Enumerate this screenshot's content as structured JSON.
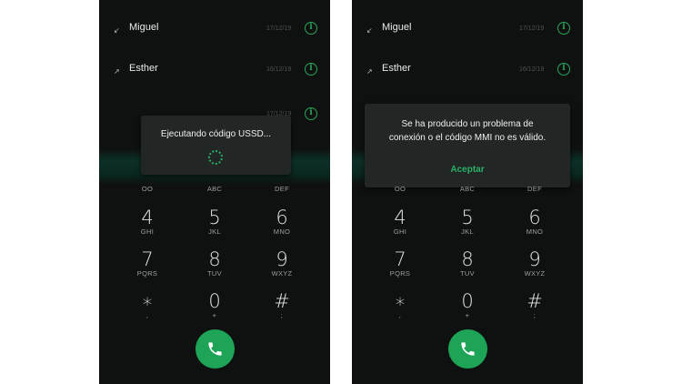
{
  "colors": {
    "accent": "#1ea456",
    "background": "#0e1110",
    "dialog": "#222625"
  },
  "left_screen": {
    "contacts": [
      {
        "name": "Miguel",
        "date": "17/12/19"
      },
      {
        "name": "Esther",
        "date": "16/12/19"
      },
      {
        "name": "",
        "date": "17/12/19"
      }
    ],
    "dialog": {
      "title": "Ejecutando código USSD..."
    },
    "keypad": [
      {
        "digit": "",
        "letters": "OO"
      },
      {
        "digit": "",
        "letters": "ABC"
      },
      {
        "digit": "",
        "letters": "DEF"
      },
      {
        "digit": "4",
        "letters": "GHI"
      },
      {
        "digit": "5",
        "letters": "JKL"
      },
      {
        "digit": "6",
        "letters": "MNO"
      },
      {
        "digit": "7",
        "letters": "PQRS"
      },
      {
        "digit": "8",
        "letters": "TUV"
      },
      {
        "digit": "9",
        "letters": "WXYZ"
      },
      {
        "digit": "∗",
        "letters": ","
      },
      {
        "digit": "0",
        "letters": "+"
      },
      {
        "digit": "#",
        "letters": ";"
      }
    ]
  },
  "right_screen": {
    "contacts": [
      {
        "name": "Miguel",
        "date": "17/12/19"
      },
      {
        "name": "Esther",
        "date": "16/12/19"
      }
    ],
    "dialog": {
      "message_line1": "Se ha producido un problema de",
      "message_line2": "conexión o el código MMI no es válido.",
      "accept_label": "Aceptar"
    },
    "keypad": [
      {
        "digit": "",
        "letters": "OO"
      },
      {
        "digit": "",
        "letters": "ABC"
      },
      {
        "digit": "",
        "letters": "DEF"
      },
      {
        "digit": "4",
        "letters": "GHI"
      },
      {
        "digit": "5",
        "letters": "JKL"
      },
      {
        "digit": "6",
        "letters": "MNO"
      },
      {
        "digit": "7",
        "letters": "PQRS"
      },
      {
        "digit": "8",
        "letters": "TUV"
      },
      {
        "digit": "9",
        "letters": "WXYZ"
      },
      {
        "digit": "∗",
        "letters": ","
      },
      {
        "digit": "0",
        "letters": "+"
      },
      {
        "digit": "#",
        "letters": ";"
      }
    ]
  }
}
